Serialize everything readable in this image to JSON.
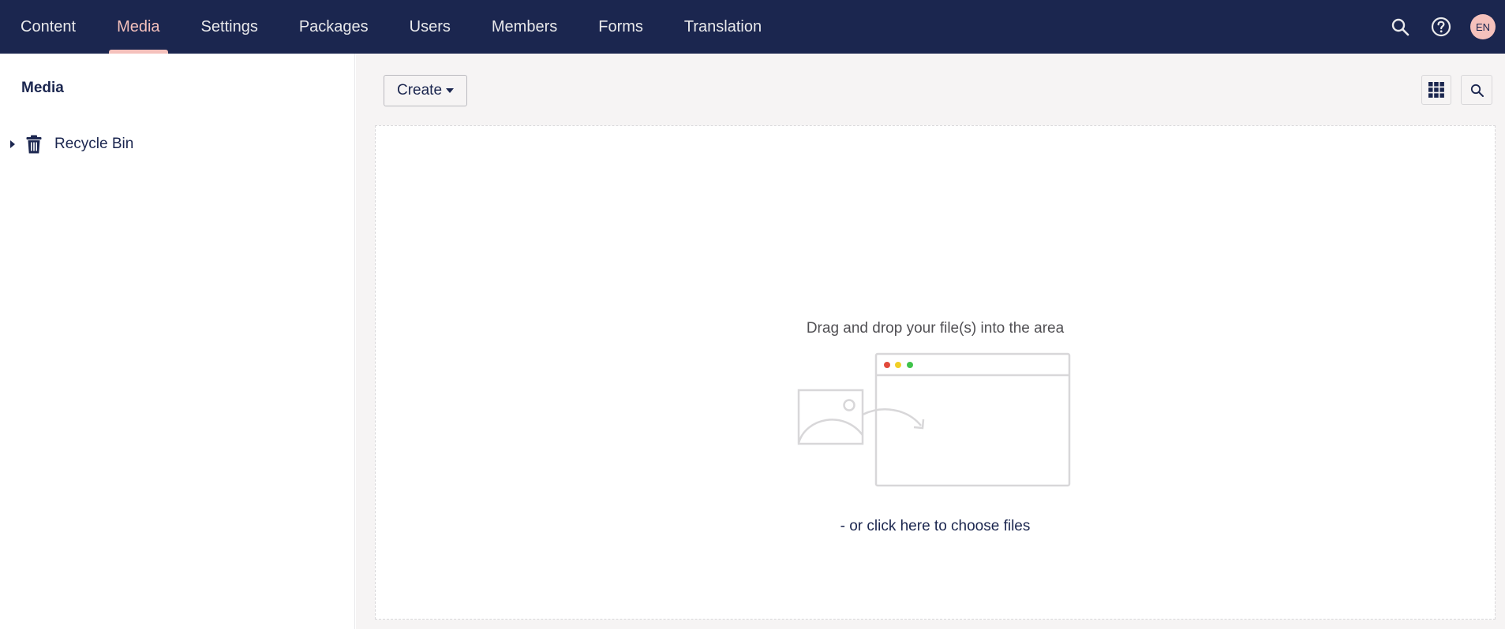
{
  "nav": {
    "items": [
      "Content",
      "Media",
      "Settings",
      "Packages",
      "Users",
      "Members",
      "Forms",
      "Translation"
    ],
    "active": "Media"
  },
  "header": {
    "search_icon": "search-icon",
    "help_icon": "help-icon",
    "avatar_initials": "EN"
  },
  "sidebar": {
    "title": "Media",
    "tree": [
      {
        "label": "Recycle Bin",
        "icon": "trash-icon"
      }
    ]
  },
  "toolbar": {
    "create_label": "Create",
    "grid_icon": "grid-view-icon",
    "search_icon": "search-icon"
  },
  "dropzone": {
    "drag_text": "Drag and drop your file(s) into the area",
    "choose_text": "- or click here to choose files"
  },
  "colors": {
    "nav_bg": "#1b264f",
    "nav_active": "#f5c1bc",
    "main_bg": "#f6f4f4",
    "text": "#1b264f",
    "dot_red": "#e24a3b",
    "dot_yellow": "#f1cf26",
    "dot_green": "#3fc34b"
  }
}
